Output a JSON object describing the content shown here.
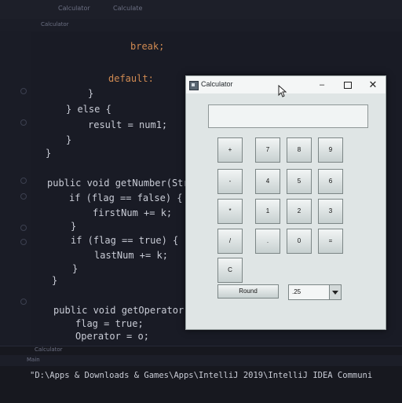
{
  "ide": {
    "tabs": [
      "Calculator",
      "Calculate"
    ],
    "editor_tab": "Calculator",
    "code_lines": [
      {
        "text": "break;",
        "class": "kw"
      },
      {
        "text": "default:",
        "class": "kw"
      },
      {
        "text": "}",
        "class": ""
      },
      {
        "text": "} else {",
        "class": ""
      },
      {
        "text": "result = num1;",
        "class": ""
      },
      {
        "text": "}",
        "class": ""
      },
      {
        "text": "}",
        "class": ""
      },
      {
        "text": "public void getNumber(Stri",
        "class": ""
      },
      {
        "text": "if (flag == false) {",
        "class": ""
      },
      {
        "text": "firstNum += k;",
        "class": ""
      },
      {
        "text": "}",
        "class": ""
      },
      {
        "text": "if (flag == true) {",
        "class": ""
      },
      {
        "text": "lastNum += k;",
        "class": ""
      },
      {
        "text": "}",
        "class": ""
      },
      {
        "text": "}",
        "class": ""
      },
      {
        "text": "public void getOperator(St",
        "class": ""
      },
      {
        "text": "flag = true;",
        "class": ""
      },
      {
        "text": "Operator = o;",
        "class": ""
      }
    ],
    "bottom_tab": "Calculator",
    "run_tab": "Main",
    "console_text": "\"D:\\Apps & Downloads & Games\\Apps\\IntelliJ 2019\\IntelliJ IDEA Communi"
  },
  "calculator": {
    "title": "Calculator",
    "minimize": "–",
    "close": "✕",
    "display_value": "",
    "keys": [
      {
        "label": "+",
        "row": 0,
        "col": 0
      },
      {
        "label": "7",
        "row": 0,
        "col": 1
      },
      {
        "label": "8",
        "row": 0,
        "col": 2
      },
      {
        "label": "9",
        "row": 0,
        "col": 3
      },
      {
        "label": "-",
        "row": 1,
        "col": 0
      },
      {
        "label": "4",
        "row": 1,
        "col": 1
      },
      {
        "label": "5",
        "row": 1,
        "col": 2
      },
      {
        "label": "6",
        "row": 1,
        "col": 3
      },
      {
        "label": "*",
        "row": 2,
        "col": 0
      },
      {
        "label": "1",
        "row": 2,
        "col": 1
      },
      {
        "label": "2",
        "row": 2,
        "col": 2
      },
      {
        "label": "3",
        "row": 2,
        "col": 3
      },
      {
        "label": "/",
        "row": 3,
        "col": 0
      },
      {
        "label": ".",
        "row": 3,
        "col": 1
      },
      {
        "label": "0",
        "row": 3,
        "col": 2
      },
      {
        "label": "=",
        "row": 3,
        "col": 3
      },
      {
        "label": "C",
        "row": 4,
        "col": 0
      }
    ],
    "round_label": "Round",
    "round_places": ".25"
  }
}
